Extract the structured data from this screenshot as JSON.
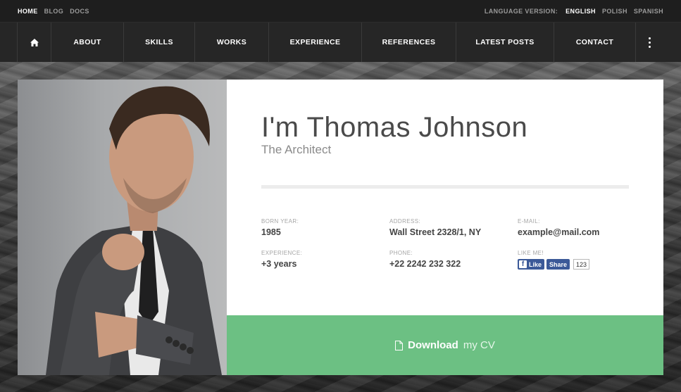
{
  "topbar": {
    "links": [
      "HOME",
      "BLOG",
      "DOCS"
    ],
    "language_label": "LANGUAGE VERSION:",
    "languages": [
      "ENGLISH",
      "POLISH",
      "SPANISH"
    ]
  },
  "nav": {
    "items": [
      "ABOUT",
      "SKILLS",
      "WORKS",
      "EXPERIENCE",
      "REFERENCES",
      "LATEST POSTS",
      "CONTACT"
    ]
  },
  "profile": {
    "name": "I'm Thomas Johnson",
    "title": "The Architect",
    "born_label": "BORN YEAR:",
    "born_value": "1985",
    "address_label": "ADDRESS:",
    "address_value": "Wall Street 2328/1, NY",
    "email_label": "E-MAIL:",
    "email_value": "example@mail.com",
    "experience_label": "EXPERIENCE:",
    "experience_value": "+3 years",
    "phone_label": "PHONE:",
    "phone_value": "+22 2242 232 322",
    "like_label": "LIKE ME!",
    "fb_like": "Like",
    "fb_share": "Share",
    "fb_count": "123"
  },
  "download": {
    "strong": "Download",
    "light": "my CV"
  },
  "colors": {
    "download_bg": "#6cc083",
    "facebook": "#3b5998",
    "nav_bg": "#262626"
  },
  "icons": {
    "home": "home-icon",
    "more": "vertical-dots-icon",
    "document": "document-icon",
    "facebook": "facebook-icon"
  }
}
